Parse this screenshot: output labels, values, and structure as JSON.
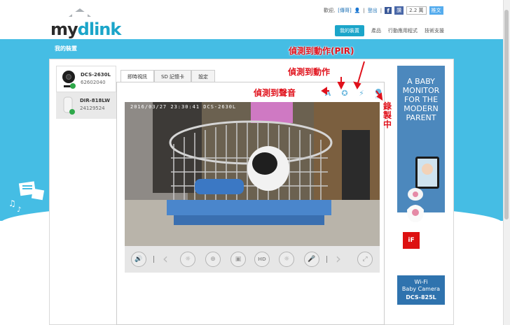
{
  "header": {
    "logo_text_a": "my",
    "logo_text_b": "dlink",
    "welcome": "歡迎,",
    "user": "[傳哥]",
    "logout": "登出",
    "fb_like": "讚",
    "like_count": "2.2 萬",
    "tweet": "推文"
  },
  "nav": {
    "items": [
      "我的裝置",
      "產品",
      "行動應用程式",
      "技術支援"
    ]
  },
  "page_title": "我的裝置",
  "devices": [
    {
      "name": "DCS-2630L",
      "id": "62602040"
    },
    {
      "name": "DIR-818LW",
      "id": "24129524"
    }
  ],
  "tabs": [
    "即時視訊",
    "SD 記憶卡",
    "設定"
  ],
  "video": {
    "timestamp": "2016/03/27 23:30:41 DCS-2630L"
  },
  "status_icons": [
    "ear-icon",
    "running-person-icon",
    "motion-icon",
    "rec-icon"
  ],
  "rec_label": "rec",
  "annotations": {
    "pir": "偵測到動作(PIR)",
    "motion": "偵測到動作",
    "sound": "偵測到聲音",
    "recording": "錄製中"
  },
  "controls": [
    "speaker-icon",
    "brightness-icon",
    "zoom-in-icon",
    "snapshot-icon",
    "hd-icon",
    "day-night-icon",
    "microphone-icon",
    "fullscreen-icon"
  ],
  "controls_hd": "HD",
  "ad": {
    "headline": "A BABY MONITOR FOR THE MODERN PARENT",
    "footer_line1": "Wi-Fi",
    "footer_line2": "Baby Camera",
    "footer_model": "DCS-825L"
  },
  "colors": {
    "brand_blue": "#1ba5c9",
    "band_blue": "#45bde4",
    "annotation_red": "#e0111b",
    "ad_blue": "#4c88bd"
  }
}
